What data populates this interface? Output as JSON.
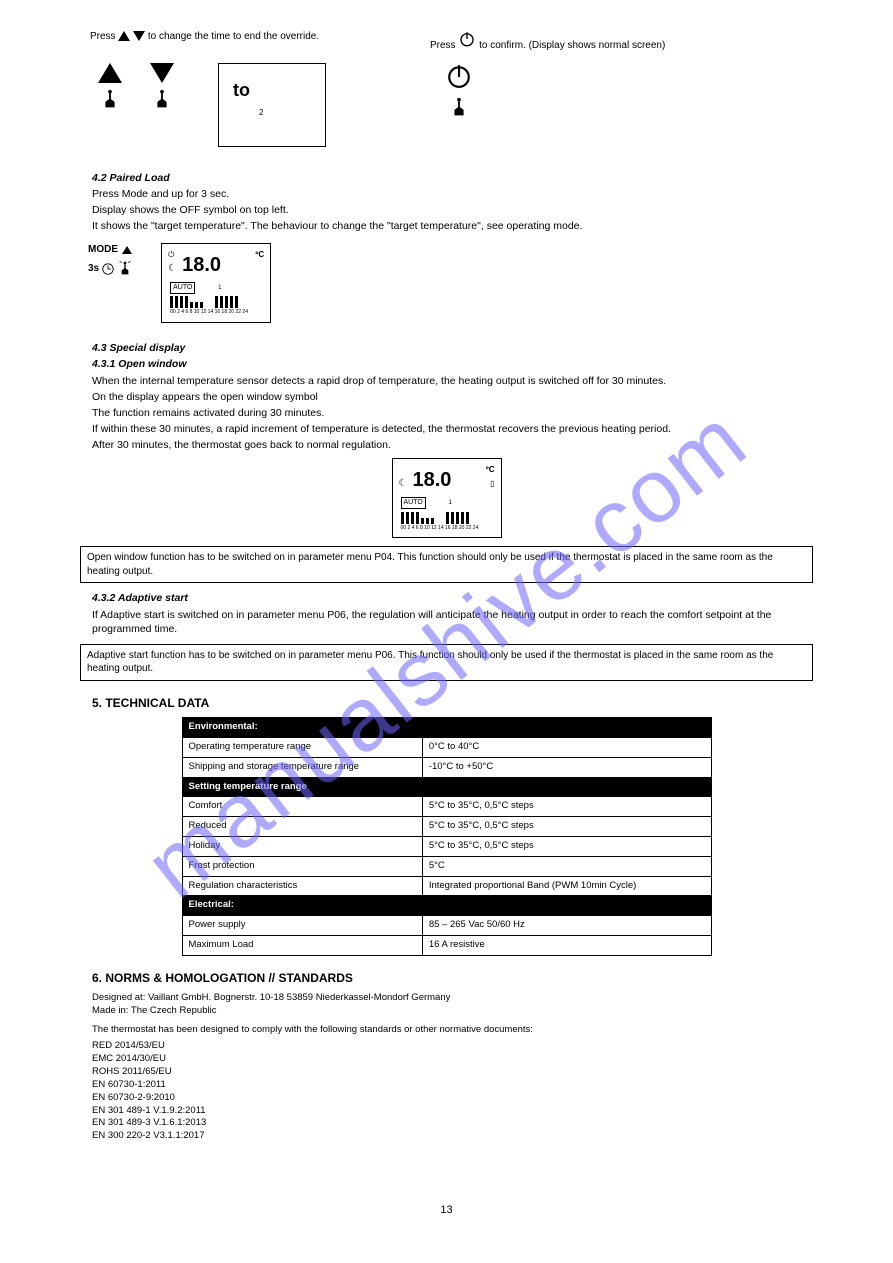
{
  "section_a": {
    "label_left_prefix": "Press",
    "label_left_suffix": "to change the time to end the override.",
    "label_right_prefix": "Press",
    "label_right_suffix": "to confirm. (Display shows normal screen)",
    "disp_to": "to",
    "disp_small": "2"
  },
  "paired_load": {
    "title": "4.2 Paired Load",
    "line1": "Press Mode and up for 3 sec.",
    "line2": "Display shows the OFF symbol on top left.",
    "line3": "It shows the \"target temperature\". The behaviour to change the \"target temperature\", see operating mode.",
    "mode_label": "MODE",
    "timer_label": "3s",
    "lcd_temp": "18.0",
    "lcd_unit": "ºC",
    "lcd_auto": "AUTO",
    "lcd_day": "1",
    "lcd_hours": "00 2 4 6 8 10 12 14 16 18 20 22 24"
  },
  "special": {
    "title": "4.3 Special display",
    "sub_title": "4.3.1 Open window",
    "line1": "When the internal temperature sensor detects a rapid drop of temperature, the heating output is switched off for 30 minutes.",
    "line2": "On the display appears the open window symbol",
    "line3": "The function remains activated during 30 minutes.",
    "line4": "If within these 30 minutes, a rapid increment of temperature is detected, the thermostat recovers the previous heating period.",
    "line5": "After 30 minutes, the thermostat goes back to normal regulation.",
    "lcd_temp": "18.0",
    "lcd_unit": "ºC",
    "lcd_auto": "AUTO",
    "lcd_day": "1",
    "lcd_hours": "00 2 4 6 8 10 12 14 16 18 20 22 24"
  },
  "note_open_window": "Open window function has to be switched on in parameter menu P04. This function should only be used if the thermostat is placed in the same room as the heating output.",
  "adaptive": {
    "title": "4.3.2 Adaptive start",
    "body": "If Adaptive start is switched on in parameter menu P06, the regulation will anticipate the heating output in order to reach the comfort setpoint at the programmed time."
  },
  "note_adaptive": "Adaptive start function has to be switched on in parameter menu P06. This function should only be used if the thermostat is placed in the same room as the heating output.",
  "tech_title": "5. TECHNICAL DATA",
  "spec": {
    "h_env": "Environmental:",
    "rows_env": [
      [
        "Operating temperature range",
        "0°C to 40°C"
      ],
      [
        "Shipping and storage temperature range",
        "-10°C to +50°C"
      ]
    ],
    "h_range": "Setting temperature range",
    "rows_range": [
      [
        "Comfort",
        "5°C to 35°C, 0,5°C steps"
      ],
      [
        "Reduced",
        "5°C to 35°C, 0,5°C steps"
      ],
      [
        "Holiday",
        "5°C to 35°C, 0,5°C steps"
      ],
      [
        "Frost protection",
        "5°C"
      ],
      [
        "Regulation characteristics",
        "Integrated proportional Band (PWM 10min Cycle)"
      ]
    ],
    "h_elec": "Electrical:",
    "rows_elec": [
      [
        "Power supply",
        "85 – 265 Vac 50/60 Hz"
      ],
      [
        "Maximum Load",
        "16 A resistive"
      ]
    ]
  },
  "norms": {
    "title": "6. NORMS & HOMOLOGATION // STANDARDS",
    "designed": "Designed at: Vaillant GmbH. Bognerstr. 10-18 53859 Niederkassel-Mondorf Germany",
    "made": "Made in: The Czech Republic",
    "body": "The thermostat has been designed to comply with the following standards or other normative documents:",
    "list": [
      "RED 2014/53/EU",
      "EMC 2014/30/EU",
      "ROHS 2011/65/EU",
      "EN 60730-1:2011",
      "EN 60730-2-9:2010",
      "EN 301 489-1 V.1.9.2:2011",
      "EN 301 489-3 V.1.6.1:2013",
      "EN 300 220-2 V3.1.1:2017"
    ]
  },
  "page_number": "13"
}
